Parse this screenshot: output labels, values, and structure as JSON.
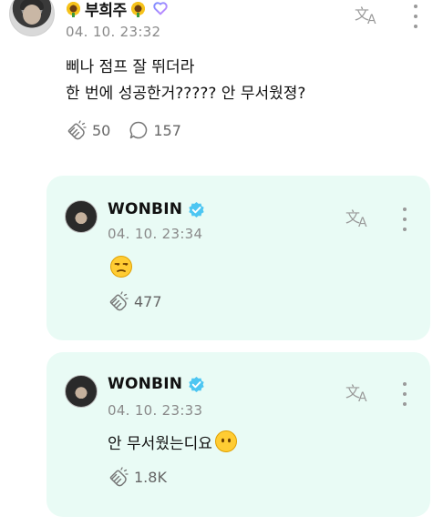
{
  "fan_post": {
    "username": "부희주",
    "timestamp": "04. 10. 23:32",
    "body": "삐나 점프 잘 뛰더라\n한 번에 성공한거????? 안 무서웠졍?",
    "likes": "50",
    "comments": "157",
    "icons": [
      "sunflower-icon",
      "heart-icon",
      "translate-icon",
      "kebab-menu-icon",
      "clap-icon",
      "comment-bubble-icon"
    ]
  },
  "replies": [
    {
      "username": "WONBIN",
      "timestamp": "04. 10. 23:34",
      "body": "",
      "emoji": "unamused-face-emoji",
      "likes": "477"
    },
    {
      "username": "WONBIN",
      "timestamp": "04. 10. 23:33",
      "body": "안 무서웠는디요",
      "emoji": "no-mouth-face-emoji",
      "likes": "1.8K"
    }
  ],
  "colors": {
    "reply_background": "#e9fbf5",
    "verified_badge": "#4dc6f2",
    "heart_gradient_start": "#7b8cff",
    "heart_gradient_end": "#c98bff",
    "emoji_yellow": "#ffcc33",
    "muted_text": "#8a8a8a"
  }
}
